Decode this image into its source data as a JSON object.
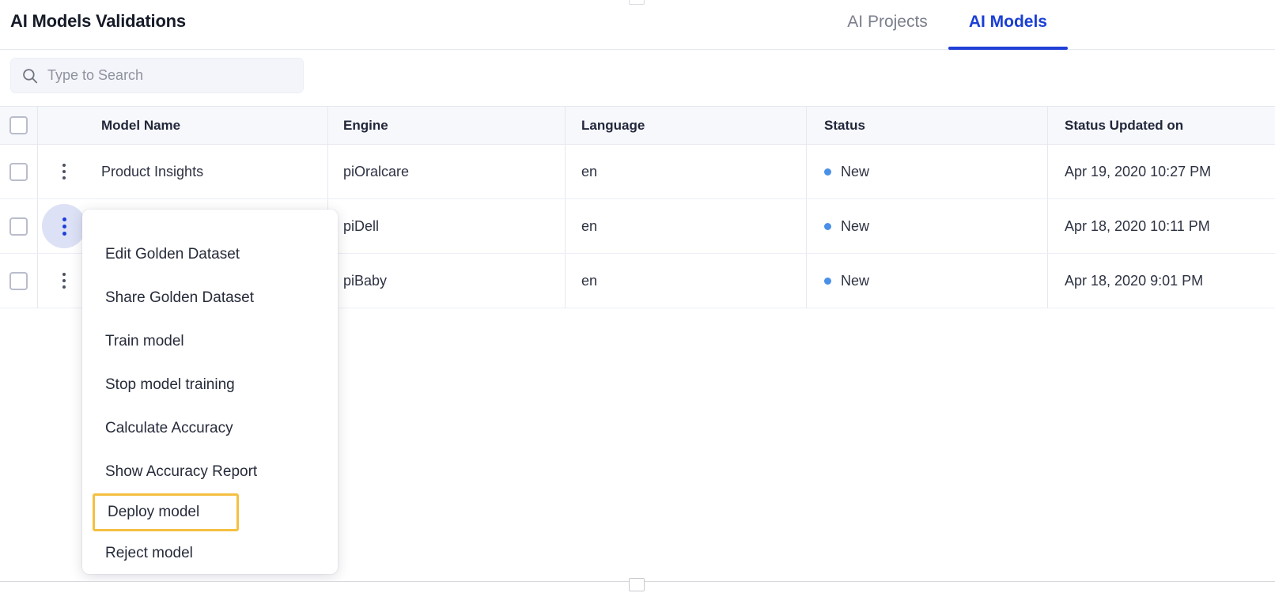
{
  "header": {
    "title": "AI Models Validations",
    "tabs": [
      {
        "label": "AI Projects",
        "active": false
      },
      {
        "label": "AI Models",
        "active": true
      }
    ],
    "accent_color": "#1a3fd4"
  },
  "search": {
    "placeholder": "Type to Search",
    "value": "",
    "icon": "search-icon"
  },
  "table": {
    "columns": [
      "Model Name",
      "Engine",
      "Language",
      "Status",
      "Status Updated on"
    ],
    "rows": [
      {
        "model_name": "Product Insights",
        "engine": "piOralcare",
        "language": "en",
        "status": "New",
        "status_updated_on": "Apr 19, 2020 10:27 PM",
        "menu_open": false
      },
      {
        "model_name": "",
        "engine": "piDell",
        "language": "en",
        "status": "New",
        "status_updated_on": "Apr 18, 2020 10:11 PM",
        "menu_open": true
      },
      {
        "model_name": "",
        "engine": "piBaby",
        "language": "en",
        "status": "New",
        "status_updated_on": "Apr 18, 2020 9:01 PM",
        "menu_open": false
      }
    ],
    "status_dot_color": "#4a90e8"
  },
  "context_menu": {
    "items": [
      {
        "label": "Edit Golden Dataset",
        "highlighted": false
      },
      {
        "label": "Share Golden Dataset",
        "highlighted": false
      },
      {
        "label": "Train model",
        "highlighted": false
      },
      {
        "label": "Stop model training",
        "highlighted": false
      },
      {
        "label": "Calculate Accuracy",
        "highlighted": false
      },
      {
        "label": "Show Accuracy Report",
        "highlighted": false
      },
      {
        "label": "Deploy model",
        "highlighted": true
      },
      {
        "label": "Reject model",
        "highlighted": false
      }
    ],
    "highlight_color": "#f5bf42"
  }
}
